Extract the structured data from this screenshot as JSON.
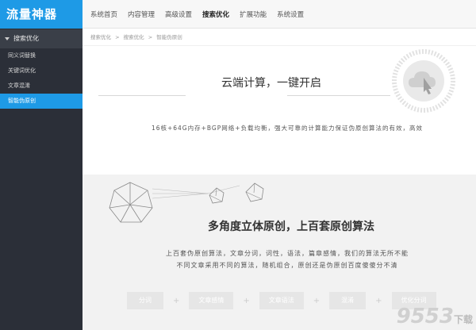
{
  "app": {
    "title": "流量神器"
  },
  "sidebar": {
    "group_label": "搜索优化",
    "items": [
      {
        "label": "同义词替换"
      },
      {
        "label": "关键词优化"
      },
      {
        "label": "文章混淆"
      },
      {
        "label": "智能伪原创"
      }
    ]
  },
  "topnav": {
    "tabs": [
      {
        "label": "系统首页"
      },
      {
        "label": "内容管理"
      },
      {
        "label": "高级设置"
      },
      {
        "label": "搜索优化"
      },
      {
        "label": "扩展功能"
      },
      {
        "label": "系统设置"
      }
    ],
    "active_index": 3
  },
  "breadcrumb": [
    "搜索优化",
    ">",
    "搜索优化",
    ">",
    "智能伪原创"
  ],
  "section1": {
    "headline": "云端计算，一键开启",
    "specs": "16核+64G内存+BGP网络+负载均衡，强大可靠的计算能力保证伪原创算法的有效，高效"
  },
  "section2": {
    "headline": "多角度立体原创，上百套原创算法",
    "desc_line1": "上百套伪原创算法，文章分词，词性，语法，篇章感情，我们的算法无所不能",
    "desc_line2": "不同文章采用不同的算法，随机组合，原创还是伪原创百度傻傻分不清",
    "features": [
      "分词",
      "文章感情",
      "文章语法",
      "混淆",
      "优化分词"
    ],
    "plus": "+"
  },
  "watermark": {
    "text": "9553",
    "suffix": "下载"
  },
  "colors": {
    "brand": "#1e9ae6",
    "sidebar_bg": "#2b2f38"
  }
}
